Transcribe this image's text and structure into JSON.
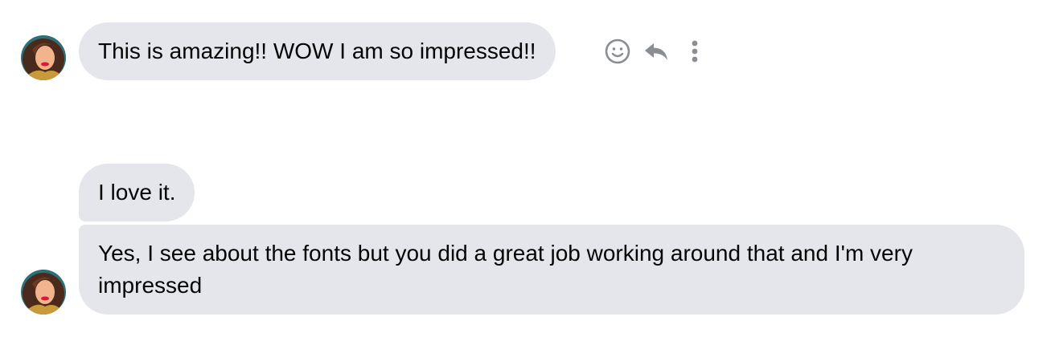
{
  "messages": [
    {
      "text": "This is amazing!! WOW I am so impressed!!"
    },
    {
      "text": "I love it."
    },
    {
      "text": "Yes, I see about the fonts but you did a great job working around that and I'm very impressed"
    }
  ],
  "message_actions": [
    "emoji-react-icon",
    "reply-icon",
    "more-options-icon"
  ],
  "colors": {
    "bubble_bg": "#e4e6eb",
    "icon": "#8a8d91",
    "text": "#050505"
  }
}
